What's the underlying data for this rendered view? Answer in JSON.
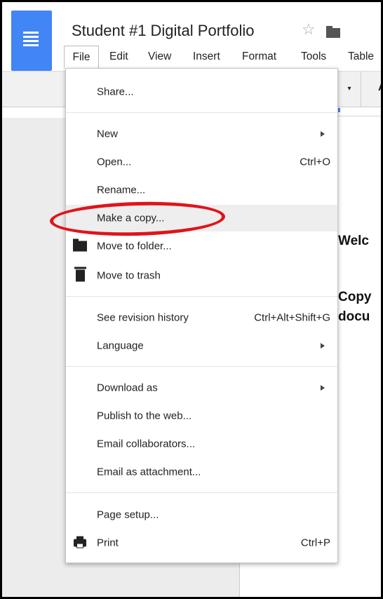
{
  "header": {
    "title": "Student #1 Digital Portfolio",
    "star_glyph": "☆"
  },
  "menubar": {
    "file": "File",
    "edit": "Edit",
    "view": "View",
    "insert": "Insert",
    "format": "Format",
    "tools": "Tools",
    "table": "Table"
  },
  "toolbar": {
    "dropdown_glyph": "▾",
    "font_partial": "A"
  },
  "document": {
    "line1": "Welc",
    "line2": "Copy",
    "line3": "docu"
  },
  "file_menu": {
    "share": "Share...",
    "new": "New",
    "open": "Open...",
    "open_shortcut": "Ctrl+O",
    "rename": "Rename...",
    "make_copy": "Make a copy...",
    "move_to_folder": "Move to folder...",
    "move_to_trash": "Move to trash",
    "revision_history": "See revision history",
    "revision_history_shortcut": "Ctrl+Alt+Shift+G",
    "language": "Language",
    "download_as": "Download as",
    "publish": "Publish to the web...",
    "email_collaborators": "Email collaborators...",
    "email_attachment": "Email as attachment...",
    "page_setup": "Page setup...",
    "print": "Print",
    "print_shortcut": "Ctrl+P"
  },
  "annotation": {
    "highlight_color": "#e0141a"
  },
  "colors": {
    "brand": "#4285f4",
    "menu_hover": "#eeeeee"
  }
}
